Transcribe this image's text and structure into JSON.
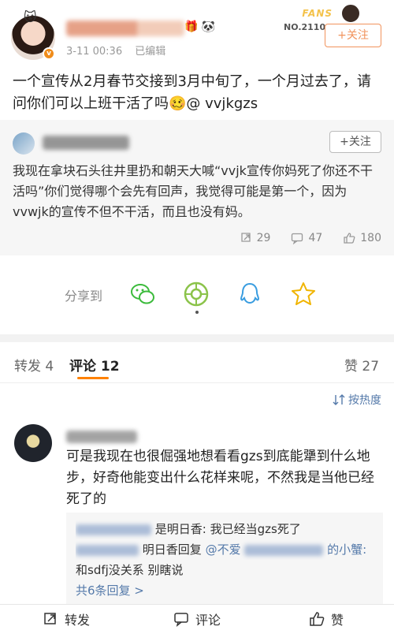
{
  "post": {
    "meta": {
      "time": "3-11 00:36",
      "edited": "已编辑"
    },
    "fans_badge": {
      "label": "FANS",
      "number": "NO.2110"
    },
    "follow_label": "+关注",
    "text": "一个宣传从2月春节交接到3月中旬了，一个月过去了，请问你们可以上班干活了吗🥴@ vvjkgzs"
  },
  "quote": {
    "follow_label": "+关注",
    "text": "我现在拿块石头往井里扔和朝天大喊“vvjk宣传你妈死了你还不干活吗”你们觉得哪个会先有回声，我觉得可能是第一个，因为vvwjk的宣传不但不干活，而且也没有妈。",
    "reposts": "29",
    "comments": "47",
    "likes": "180"
  },
  "share": {
    "label": "分享到"
  },
  "tabs": {
    "repost": "转发 4",
    "comment": "评论 12",
    "like": "赞 27"
  },
  "sort": {
    "label": "按热度"
  },
  "comment": {
    "text": "可是我现在也很倔强地想看看gzs到底能犟到什么地步，好奇他能变出什么花样来呢，不然我是当他已经死了的",
    "replies": {
      "line1_suffix": "是明日香: 我已经当gzs死了",
      "line2_mid": "明日香回复",
      "line2_at": "@不爱",
      "line2_tail": "的小蟹:",
      "line3": "和sdfj没关系 别瞎说",
      "more": "共6条回复 >"
    }
  },
  "bottom_bar": {
    "repost": "转发",
    "comment": "评论",
    "like": "赞"
  },
  "colors": {
    "accent": "#ff8200",
    "link": "#557aaa",
    "follow": "#f1935c"
  }
}
